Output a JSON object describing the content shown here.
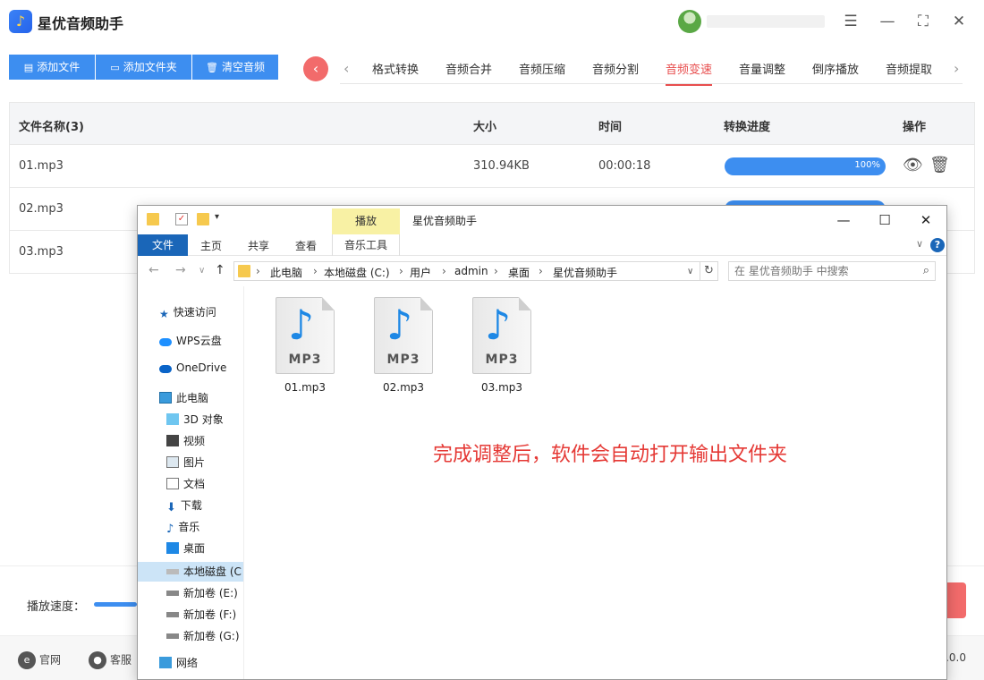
{
  "app": {
    "title": "星优音频助手",
    "toolbar": {
      "add_file": "添加文件",
      "add_folder": "添加文件夹",
      "clear": "清空音频"
    },
    "tabs": [
      "格式转换",
      "音频合并",
      "音频压缩",
      "音频分割",
      "音频变速",
      "音量调整",
      "倒序播放",
      "音频提取"
    ],
    "active_tab": "音频变速",
    "table": {
      "headers": {
        "name": "文件名称(3)",
        "size": "大小",
        "time": "时间",
        "progress": "转换进度",
        "ops": "操作"
      },
      "rows": [
        {
          "name": "01.mp3",
          "size": "310.94KB",
          "time": "00:00:18",
          "progress_text": "100%",
          "progress": 100
        },
        {
          "name": "02.mp3",
          "size": "",
          "time": "",
          "progress_text": "",
          "progress": 100
        },
        {
          "name": "03.mp3",
          "size": "",
          "time": "",
          "progress_text": "",
          "progress": 100
        }
      ]
    },
    "speed_label": "播放速度：",
    "footer": {
      "official": "官网",
      "service": "客服",
      "version": ".0.0"
    },
    "colors": {
      "primary": "#3d8ef0",
      "accent": "#e84e4e"
    }
  },
  "explorer": {
    "ribbon_context": "播放",
    "title": "星优音频助手",
    "ribbon_tabs": {
      "file": "文件",
      "home": "主页",
      "share": "共享",
      "view": "查看",
      "music_tools": "音乐工具"
    },
    "breadcrumb": [
      "此电脑",
      "本地磁盘 (C:)",
      "用户",
      "admin",
      "桌面",
      "星优音频助手"
    ],
    "search_placeholder": "在 星优音频助手 中搜索",
    "nav": [
      {
        "label": "快速访问",
        "icon": "star-icon"
      },
      {
        "label": "WPS云盘",
        "icon": "cloud-icon"
      },
      {
        "label": "OneDrive",
        "icon": "onedrive-icon"
      },
      {
        "label": "此电脑",
        "icon": "computer-icon"
      },
      {
        "label": "3D 对象",
        "icon": "cube-icon"
      },
      {
        "label": "视频",
        "icon": "video-icon"
      },
      {
        "label": "图片",
        "icon": "picture-icon"
      },
      {
        "label": "文档",
        "icon": "document-icon"
      },
      {
        "label": "下载",
        "icon": "download-icon"
      },
      {
        "label": "音乐",
        "icon": "music-icon"
      },
      {
        "label": "桌面",
        "icon": "desktop-icon"
      },
      {
        "label": "本地磁盘 (C",
        "icon": "drive-icon"
      },
      {
        "label": "新加卷 (E:)",
        "icon": "drive-icon"
      },
      {
        "label": "新加卷 (F:)",
        "icon": "drive-icon"
      },
      {
        "label": "新加卷 (G:)",
        "icon": "drive-icon"
      },
      {
        "label": "网络",
        "icon": "network-icon"
      }
    ],
    "files": [
      {
        "name": "01.mp3",
        "type_label": "MP3"
      },
      {
        "name": "02.mp3",
        "type_label": "MP3"
      },
      {
        "name": "03.mp3",
        "type_label": "MP3"
      }
    ]
  },
  "annotation": "完成调整后，软件会自动打开输出文件夹"
}
